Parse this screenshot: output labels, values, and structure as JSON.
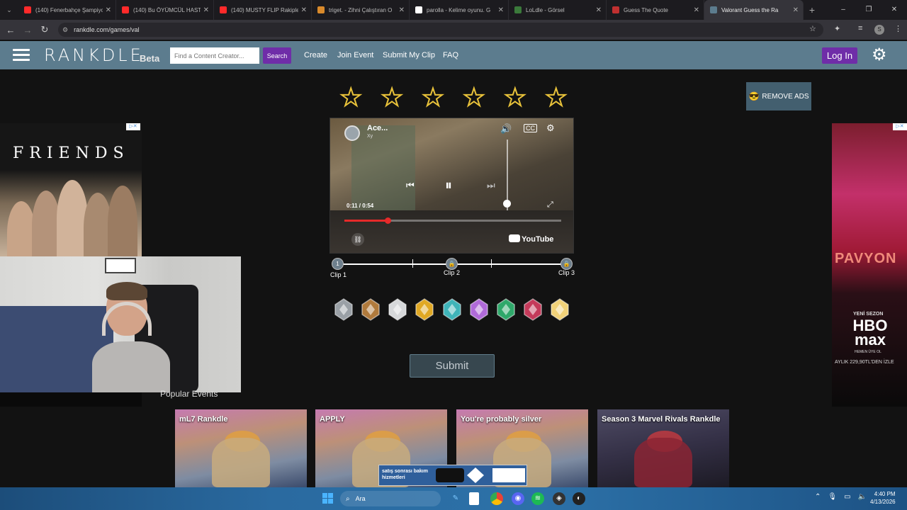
{
  "browser": {
    "tabs": [
      {
        "label": "(140) Fenerbahçe Şampiyo",
        "color": "#ff2a2a"
      },
      {
        "label": "(140) Bu ÖYÜMCÜL HASTA",
        "color": "#ff2a2a"
      },
      {
        "label": "(140) MUSTY FLIP Rakiple",
        "color": "#ff2a2a"
      },
      {
        "label": "triget. - Zihni Çalıştıran O",
        "color": "#d98a2b"
      },
      {
        "label": "parolla - Kelime oyunu. G",
        "color": "#ffffff"
      },
      {
        "label": "LoLdle - Görsel",
        "color": "#3b7a3b"
      },
      {
        "label": "Guess The Quote",
        "color": "#c03030"
      },
      {
        "label": "Valorant Guess the Ra",
        "color": "#5c7c8e",
        "active": true
      }
    ],
    "url": "rankdle.com/games/val",
    "profile_initial": "S"
  },
  "site": {
    "logo": "RANKDLE",
    "beta": "Beta",
    "search_placeholder": "Find a Content Creator...",
    "search_button": "Search",
    "nav": [
      "Create",
      "Join Event",
      "Submit My Clip",
      "FAQ"
    ],
    "remove_ads": "REMOVE ADS",
    "login": "Log In"
  },
  "game": {
    "stars_count": 6,
    "video": {
      "title": "Ace...",
      "subtitle": "Xy",
      "time": "0:11 / 0:54",
      "progress_fraction": 0.2,
      "volume_fraction": 0.15,
      "brand": "YouTube"
    },
    "clips": [
      {
        "label": "Clip 1",
        "marker": "1",
        "locked": false
      },
      {
        "label": "Clip 2",
        "marker": "🔒",
        "locked": true
      },
      {
        "label": "Clip 3",
        "marker": "🔒",
        "locked": true
      }
    ],
    "ranks": [
      {
        "name": "iron",
        "color": "#9aa0a6"
      },
      {
        "name": "bronze",
        "color": "#b07a3c"
      },
      {
        "name": "silver",
        "color": "#d6d8da"
      },
      {
        "name": "gold",
        "color": "#e0a824"
      },
      {
        "name": "platinum",
        "color": "#3fb4b9"
      },
      {
        "name": "diamond",
        "color": "#b06ad8"
      },
      {
        "name": "ascendant",
        "color": "#2fa86a"
      },
      {
        "name": "immortal",
        "color": "#c43a5a"
      },
      {
        "name": "radiant",
        "color": "#f1d279"
      }
    ],
    "submit": "Submit"
  },
  "ads": {
    "left_title": "FRIENDS",
    "right_title": "PAVYON",
    "right_new": "YENİ SEZON",
    "right_brand": "HBO max",
    "right_member": "HEMEN ÜYE OL",
    "right_price": "AYLIK 229,90TL'DEN İZLE",
    "promo_text": "satış sonrası bakım hizmetleri"
  },
  "popular": {
    "title": "Popular Events",
    "events": [
      {
        "label": "mL7 Rankdle"
      },
      {
        "label": "APPLY"
      },
      {
        "label": "You're probably silver"
      },
      {
        "label": "Season 3 Marvel Rivals Rankdle"
      }
    ]
  },
  "taskbar": {
    "search_label": "Ara",
    "time": "4:40 PM",
    "date": "4/13/2026"
  }
}
